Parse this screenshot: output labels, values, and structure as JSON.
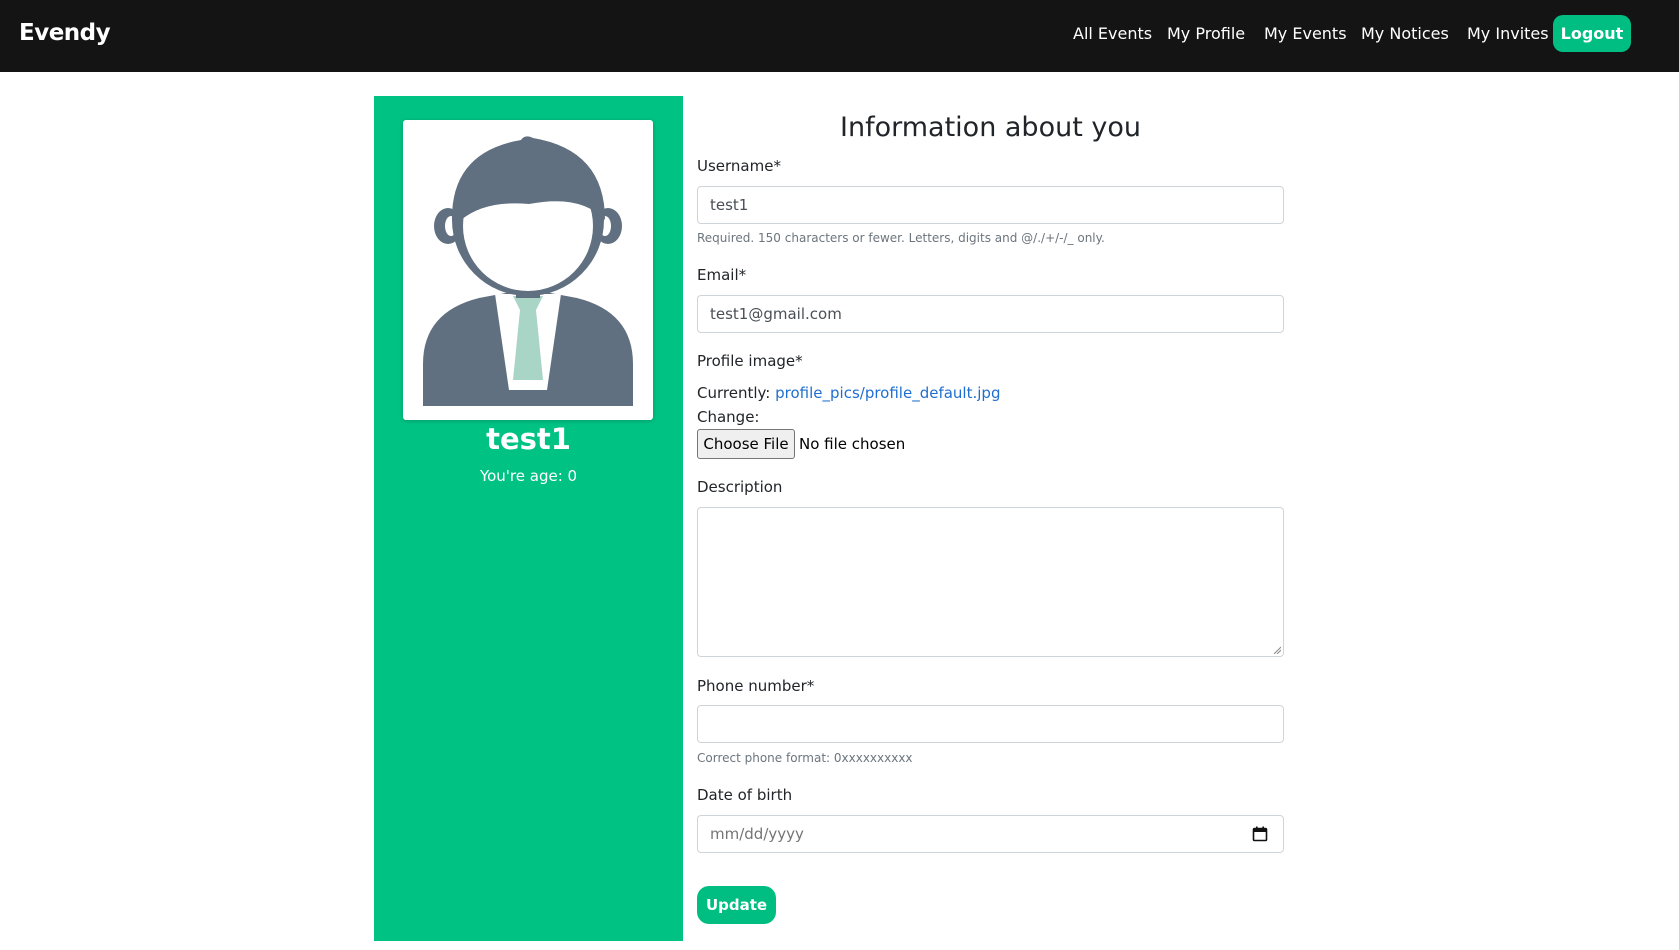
{
  "nav": {
    "brand": "Evendy",
    "links": [
      "All Events",
      "My Profile",
      "My Events",
      "My Notices",
      "My Invites"
    ],
    "logout": "Logout"
  },
  "sidebar": {
    "username": "test1",
    "age_text": "You're age: 0"
  },
  "form": {
    "title": "Information about you",
    "username": {
      "label": "Username*",
      "value": "test1",
      "help": "Required. 150 characters or fewer. Letters, digits and @/./+/-/_ only."
    },
    "email": {
      "label": "Email*",
      "value": "test1@gmail.com"
    },
    "profile_image": {
      "label": "Profile image*",
      "currently_label": "Currently:",
      "current_file": "profile_pics/profile_default.jpg",
      "change_label": "Change:",
      "choose_button": "Choose File",
      "file_status": "No file chosen"
    },
    "description": {
      "label": "Description",
      "value": ""
    },
    "phone": {
      "label": "Phone number*",
      "value": "",
      "help": "Correct phone format: 0xxxxxxxxxx"
    },
    "dob": {
      "label": "Date of birth",
      "placeholder": "mm/dd/yyyy"
    },
    "submit": "Update"
  },
  "colors": {
    "accent": "#00c283",
    "navbar": "#141414",
    "link": "#1f6fd0"
  },
  "icons": {
    "avatar": "default-user-avatar-icon",
    "calendar": "calendar-icon"
  }
}
